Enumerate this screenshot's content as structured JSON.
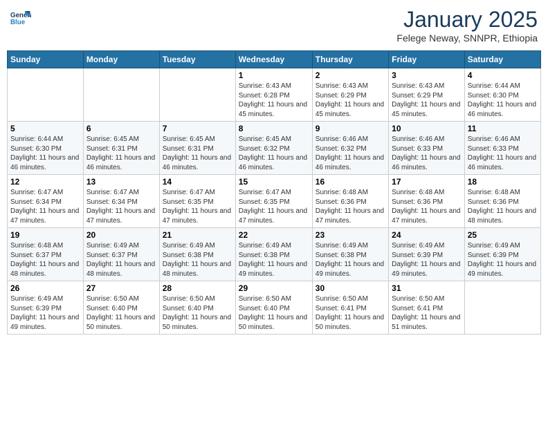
{
  "header": {
    "logo_line1": "General",
    "logo_line2": "Blue",
    "month": "January 2025",
    "location": "Felege Neway, SNNPR, Ethiopia"
  },
  "days_of_week": [
    "Sunday",
    "Monday",
    "Tuesday",
    "Wednesday",
    "Thursday",
    "Friday",
    "Saturday"
  ],
  "weeks": [
    [
      {
        "day": "",
        "info": ""
      },
      {
        "day": "",
        "info": ""
      },
      {
        "day": "",
        "info": ""
      },
      {
        "day": "1",
        "info": "Sunrise: 6:43 AM\nSunset: 6:28 PM\nDaylight: 11 hours and 45 minutes."
      },
      {
        "day": "2",
        "info": "Sunrise: 6:43 AM\nSunset: 6:29 PM\nDaylight: 11 hours and 45 minutes."
      },
      {
        "day": "3",
        "info": "Sunrise: 6:43 AM\nSunset: 6:29 PM\nDaylight: 11 hours and 45 minutes."
      },
      {
        "day": "4",
        "info": "Sunrise: 6:44 AM\nSunset: 6:30 PM\nDaylight: 11 hours and 46 minutes."
      }
    ],
    [
      {
        "day": "5",
        "info": "Sunrise: 6:44 AM\nSunset: 6:30 PM\nDaylight: 11 hours and 46 minutes."
      },
      {
        "day": "6",
        "info": "Sunrise: 6:45 AM\nSunset: 6:31 PM\nDaylight: 11 hours and 46 minutes."
      },
      {
        "day": "7",
        "info": "Sunrise: 6:45 AM\nSunset: 6:31 PM\nDaylight: 11 hours and 46 minutes."
      },
      {
        "day": "8",
        "info": "Sunrise: 6:45 AM\nSunset: 6:32 PM\nDaylight: 11 hours and 46 minutes."
      },
      {
        "day": "9",
        "info": "Sunrise: 6:46 AM\nSunset: 6:32 PM\nDaylight: 11 hours and 46 minutes."
      },
      {
        "day": "10",
        "info": "Sunrise: 6:46 AM\nSunset: 6:33 PM\nDaylight: 11 hours and 46 minutes."
      },
      {
        "day": "11",
        "info": "Sunrise: 6:46 AM\nSunset: 6:33 PM\nDaylight: 11 hours and 46 minutes."
      }
    ],
    [
      {
        "day": "12",
        "info": "Sunrise: 6:47 AM\nSunset: 6:34 PM\nDaylight: 11 hours and 47 minutes."
      },
      {
        "day": "13",
        "info": "Sunrise: 6:47 AM\nSunset: 6:34 PM\nDaylight: 11 hours and 47 minutes."
      },
      {
        "day": "14",
        "info": "Sunrise: 6:47 AM\nSunset: 6:35 PM\nDaylight: 11 hours and 47 minutes."
      },
      {
        "day": "15",
        "info": "Sunrise: 6:47 AM\nSunset: 6:35 PM\nDaylight: 11 hours and 47 minutes."
      },
      {
        "day": "16",
        "info": "Sunrise: 6:48 AM\nSunset: 6:36 PM\nDaylight: 11 hours and 47 minutes."
      },
      {
        "day": "17",
        "info": "Sunrise: 6:48 AM\nSunset: 6:36 PM\nDaylight: 11 hours and 47 minutes."
      },
      {
        "day": "18",
        "info": "Sunrise: 6:48 AM\nSunset: 6:36 PM\nDaylight: 11 hours and 48 minutes."
      }
    ],
    [
      {
        "day": "19",
        "info": "Sunrise: 6:48 AM\nSunset: 6:37 PM\nDaylight: 11 hours and 48 minutes."
      },
      {
        "day": "20",
        "info": "Sunrise: 6:49 AM\nSunset: 6:37 PM\nDaylight: 11 hours and 48 minutes."
      },
      {
        "day": "21",
        "info": "Sunrise: 6:49 AM\nSunset: 6:38 PM\nDaylight: 11 hours and 48 minutes."
      },
      {
        "day": "22",
        "info": "Sunrise: 6:49 AM\nSunset: 6:38 PM\nDaylight: 11 hours and 49 minutes."
      },
      {
        "day": "23",
        "info": "Sunrise: 6:49 AM\nSunset: 6:38 PM\nDaylight: 11 hours and 49 minutes."
      },
      {
        "day": "24",
        "info": "Sunrise: 6:49 AM\nSunset: 6:39 PM\nDaylight: 11 hours and 49 minutes."
      },
      {
        "day": "25",
        "info": "Sunrise: 6:49 AM\nSunset: 6:39 PM\nDaylight: 11 hours and 49 minutes."
      }
    ],
    [
      {
        "day": "26",
        "info": "Sunrise: 6:49 AM\nSunset: 6:39 PM\nDaylight: 11 hours and 49 minutes."
      },
      {
        "day": "27",
        "info": "Sunrise: 6:50 AM\nSunset: 6:40 PM\nDaylight: 11 hours and 50 minutes."
      },
      {
        "day": "28",
        "info": "Sunrise: 6:50 AM\nSunset: 6:40 PM\nDaylight: 11 hours and 50 minutes."
      },
      {
        "day": "29",
        "info": "Sunrise: 6:50 AM\nSunset: 6:40 PM\nDaylight: 11 hours and 50 minutes."
      },
      {
        "day": "30",
        "info": "Sunrise: 6:50 AM\nSunset: 6:41 PM\nDaylight: 11 hours and 50 minutes."
      },
      {
        "day": "31",
        "info": "Sunrise: 6:50 AM\nSunset: 6:41 PM\nDaylight: 11 hours and 51 minutes."
      },
      {
        "day": "",
        "info": ""
      }
    ]
  ]
}
